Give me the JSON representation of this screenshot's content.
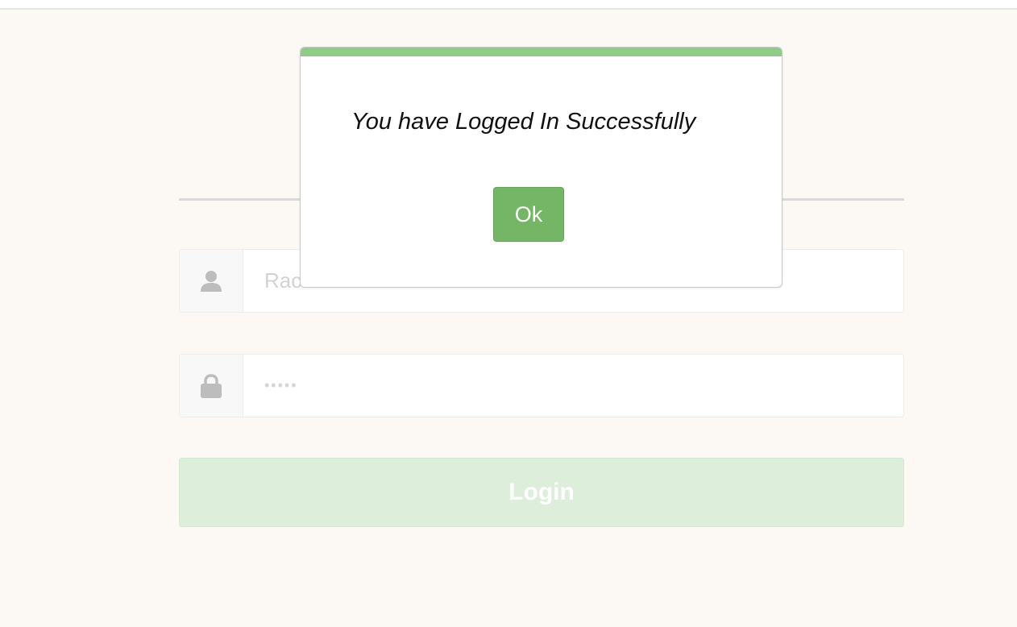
{
  "dialog": {
    "message": "You have Logged In Successfully",
    "ok_label": "Ok",
    "accent_color": "#8fcb87"
  },
  "login_form": {
    "username_value": "Rac",
    "password_value": "•••••",
    "login_label": "Login",
    "username_icon": "user-icon",
    "password_icon": "lock-icon"
  }
}
